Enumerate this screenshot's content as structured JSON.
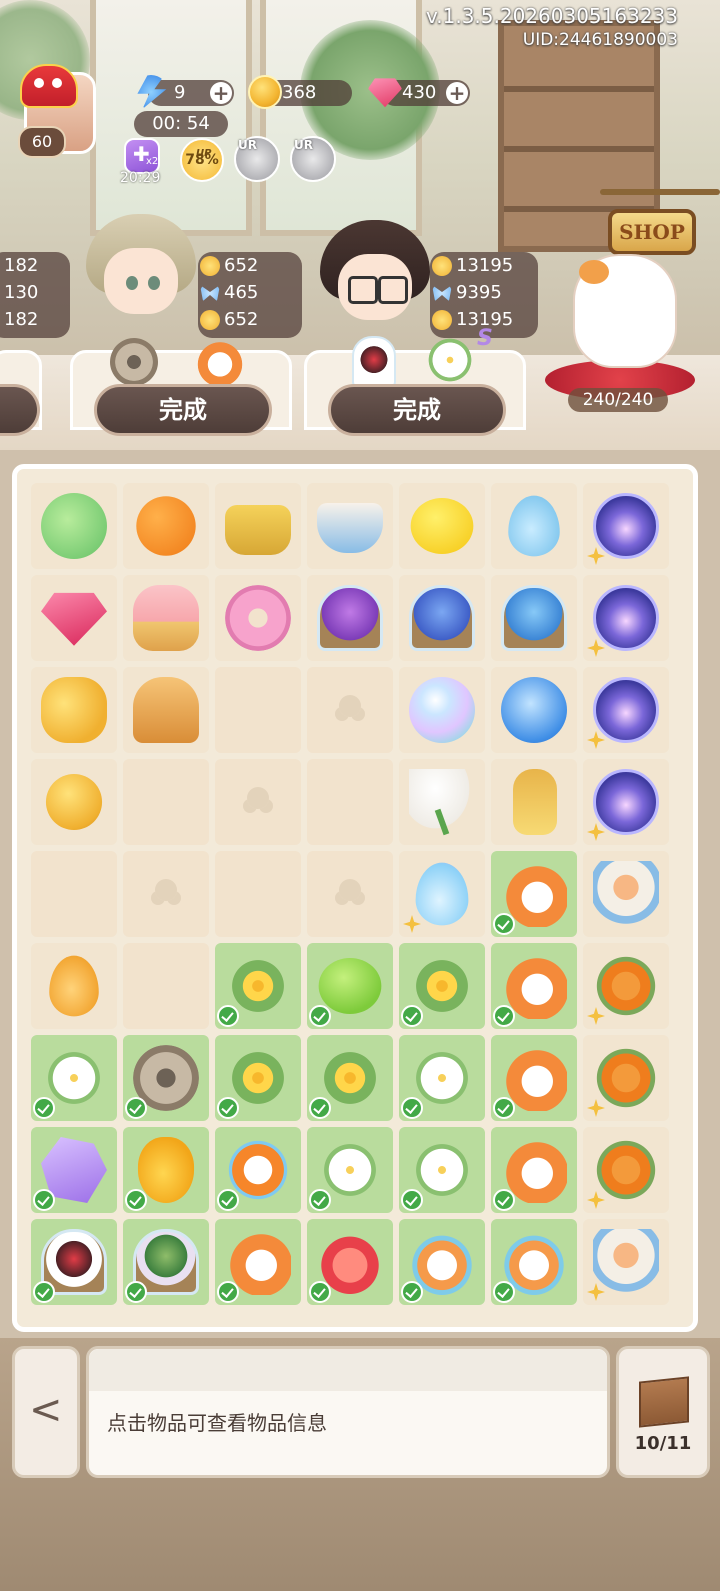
{
  "header": {
    "version": "v.1.3.5.20260305163233",
    "uid": "UID:24461890003",
    "player_level": "60",
    "energy": "9",
    "energy_timer": "00: 54",
    "coins": "368",
    "gems": "430",
    "buff_multiplier": "x2",
    "buff_timer": "20:29",
    "up_label": "UP",
    "up_percent": "78%",
    "ur_label_1": "UR",
    "ur_label_2": "UR",
    "shop_label": "SHOP",
    "cat_counter": "240/240"
  },
  "orders": [
    {
      "stats": [
        "182",
        "130",
        "182"
      ]
    },
    {
      "stats": [
        "652",
        "465",
        "652"
      ],
      "button_label": "完成"
    },
    {
      "stats": [
        "13195",
        "9395",
        "13195"
      ],
      "button_label": "完成",
      "badge": "S"
    }
  ],
  "board": {
    "rows": [
      [
        "pomegranate",
        "orange",
        "basket",
        "teacup",
        "lemon",
        "drop",
        "galaxy"
      ],
      [
        "gem",
        "tart",
        "donut",
        "jar-purple",
        "jar-blue",
        "jar-blue2",
        "galaxy"
      ],
      [
        "coins",
        "bread",
        "empty",
        "ghost",
        "opal",
        "bolt",
        "galaxy"
      ],
      [
        "coin",
        "empty",
        "ghost",
        "empty",
        "calla",
        "perfume",
        "galaxy"
      ],
      [
        "empty",
        "ghost",
        "empty",
        "ghost",
        "waterdrop",
        "goldfish",
        "cattea"
      ],
      [
        "honeydrop",
        "empty",
        "flowers",
        "lime",
        "flowers",
        "goldfish",
        "orange-flower"
      ],
      [
        "lily",
        "gear",
        "flowers",
        "flowers",
        "lily",
        "goldfish",
        "orange-flower"
      ],
      [
        "crystal",
        "pear",
        "clownfish",
        "lily",
        "lily",
        "goldfish",
        "orange-flower"
      ],
      [
        "jar-red",
        "jar-tree",
        "goldfish",
        "redfish",
        "koi",
        "koi",
        "cattea"
      ]
    ]
  },
  "bottom": {
    "info_text": "点击物品可查看物品信息",
    "bag_count": "10/11"
  },
  "colors": {
    "done_cell": "#b9dc9d",
    "empty_cell": "#f2e3cd",
    "check": "#43a947",
    "button": "#4e3d38"
  }
}
